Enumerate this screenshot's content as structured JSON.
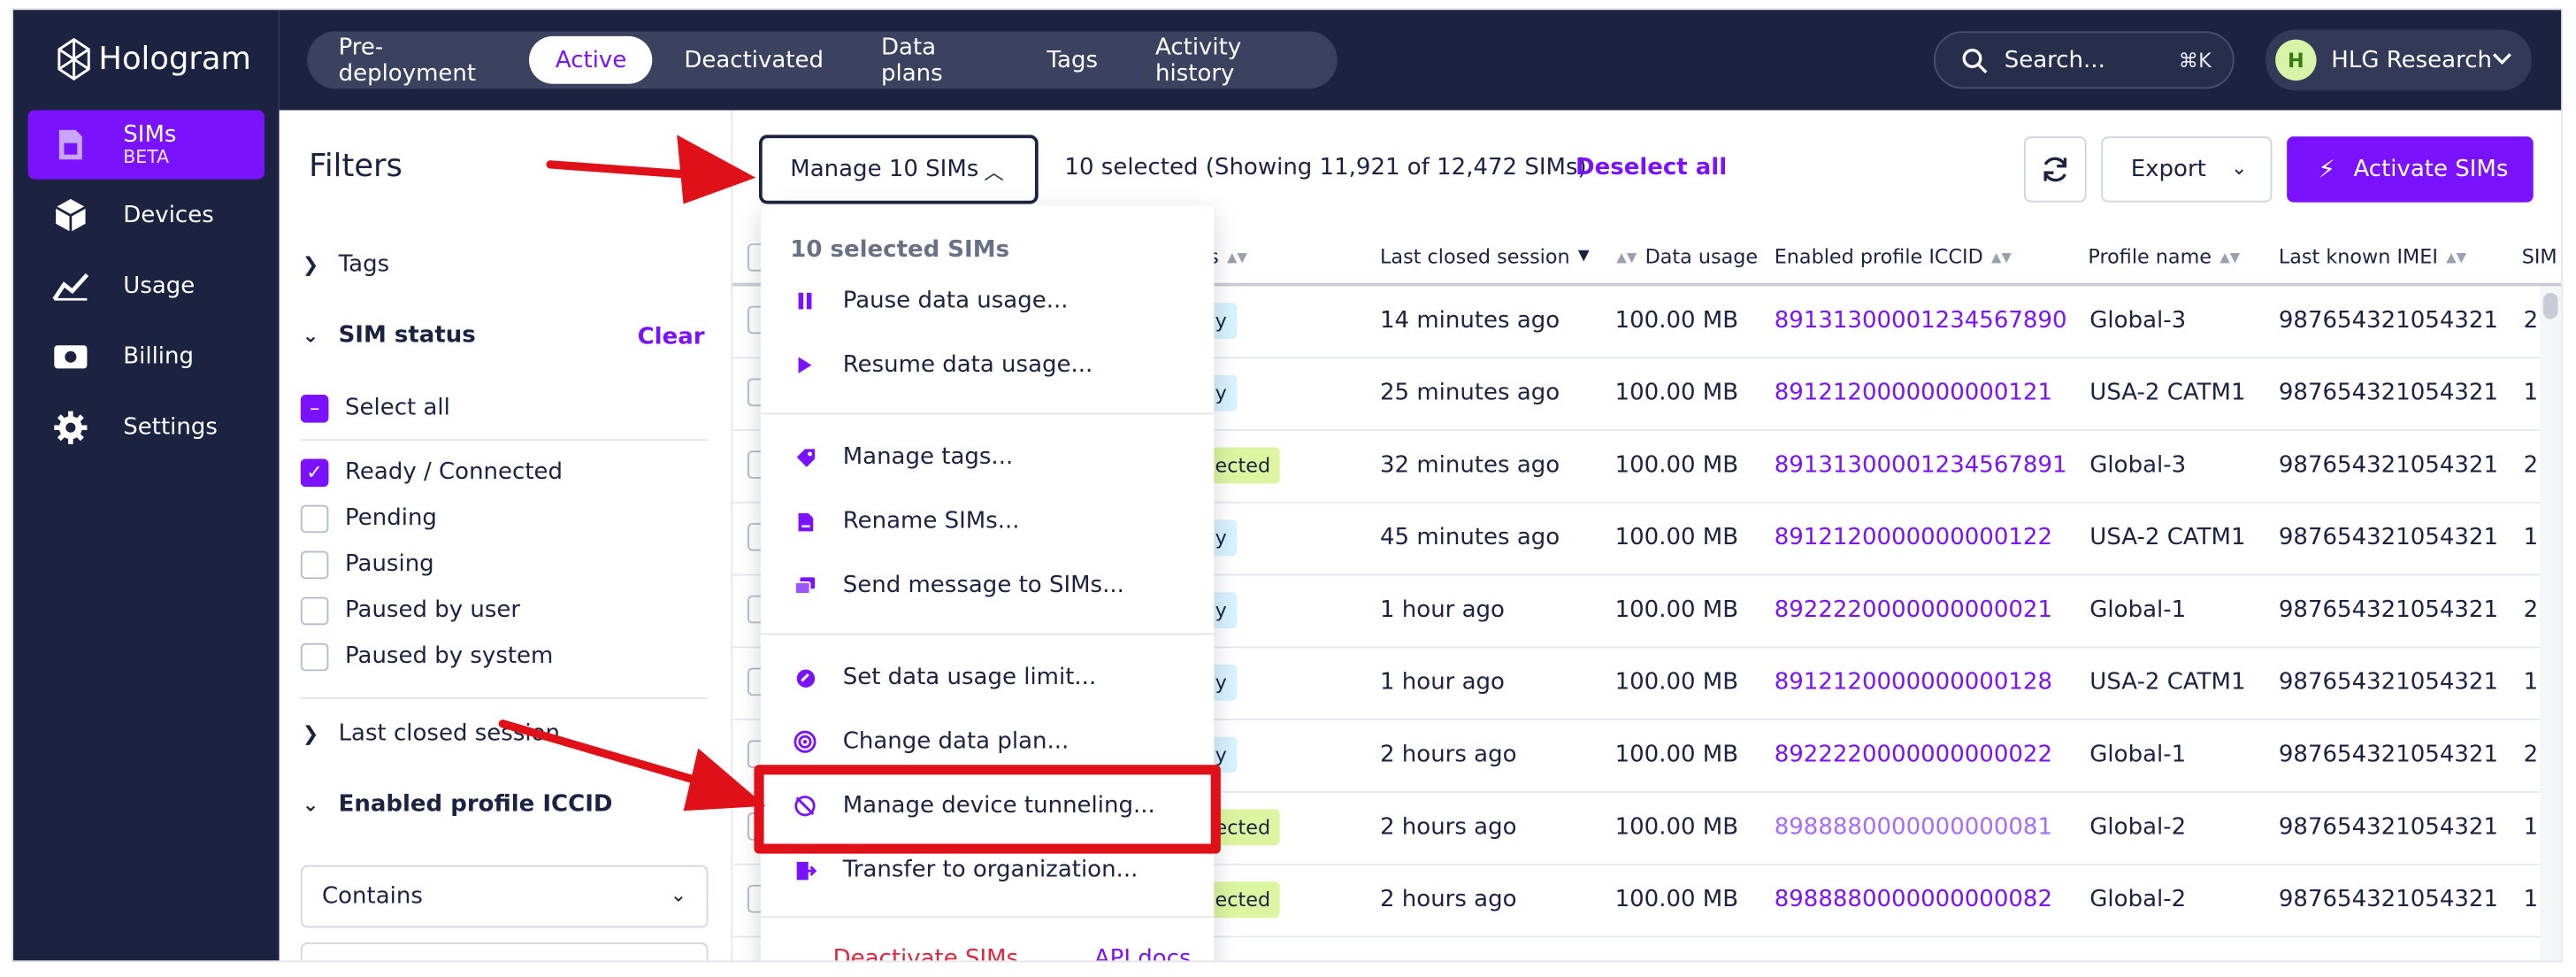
{
  "app": {
    "brand": "Hologram"
  },
  "sidebar": {
    "items": [
      {
        "label": "SIMs",
        "sub": "BETA",
        "icon": "sim-card-icon",
        "active": true
      },
      {
        "label": "Devices",
        "icon": "cube-icon"
      },
      {
        "label": "Usage",
        "icon": "chart-line-icon"
      },
      {
        "label": "Billing",
        "icon": "money-icon"
      },
      {
        "label": "Settings",
        "icon": "gear-icon"
      }
    ]
  },
  "topnav": {
    "tabs": [
      "Pre-deployment",
      "Active",
      "Deactivated",
      "Data plans",
      "Tags",
      "Activity history"
    ],
    "active_tab": "Active",
    "search_placeholder": "Search...",
    "search_shortcut": "⌘K",
    "org_initial": "H",
    "org_name": "HLG Research"
  },
  "filters": {
    "title": "Filters",
    "tags_label": "Tags",
    "sim_status_label": "SIM status",
    "clear_label": "Clear",
    "select_all": "Select all",
    "statuses": [
      {
        "label": "Ready / Connected",
        "checked": true
      },
      {
        "label": "Pending",
        "checked": false
      },
      {
        "label": "Pausing",
        "checked": false
      },
      {
        "label": "Paused by user",
        "checked": false
      },
      {
        "label": "Paused by system",
        "checked": false
      }
    ],
    "last_closed_label": "Last closed session",
    "iccid_label": "Enabled profile ICCID",
    "iccid_match": "Contains"
  },
  "toolbar": {
    "manage_label": "Manage 10 SIMs",
    "selected_text": "10 selected (Showing 11,921 of 12,472 SIMs)",
    "deselect_label": "Deselect all",
    "export_label": "Export",
    "activate_label": "Activate SIMs"
  },
  "table": {
    "headers": {
      "status_partial": "us",
      "last_closed": "Last closed session",
      "data_usage": "Data usage",
      "iccid": "Enabled profile ICCID",
      "profile": "Profile name",
      "imei": "Last known IMEI",
      "sim_partial": "SIM"
    },
    "rows": [
      {
        "badge": "dy",
        "badge_type": "ready",
        "last": "14 minutes ago",
        "usage": "100.00 MB",
        "iccid": "89131300001234567890",
        "profile": "Global-3",
        "imei": "987654321054321",
        "tail": "2"
      },
      {
        "badge": "dy",
        "badge_type": "ready",
        "last": "25 minutes ago",
        "usage": "100.00 MB",
        "iccid": "8912120000000000121",
        "profile": "USA-2 CATM1",
        "imei": "987654321054321",
        "tail": "1"
      },
      {
        "badge": "nected",
        "badge_type": "conn",
        "last": "32 minutes ago",
        "usage": "100.00 MB",
        "iccid": "89131300001234567891",
        "profile": "Global-3",
        "imei": "987654321054321",
        "tail": "2"
      },
      {
        "badge": "dy",
        "badge_type": "ready",
        "last": "45 minutes ago",
        "usage": "100.00 MB",
        "iccid": "8912120000000000122",
        "profile": "USA-2 CATM1",
        "imei": "987654321054321",
        "tail": "1"
      },
      {
        "badge": "dy",
        "badge_type": "ready",
        "last": "1 hour ago",
        "usage": "100.00 MB",
        "iccid": "8922220000000000021",
        "profile": "Global-1",
        "imei": "987654321054321",
        "tail": "2"
      },
      {
        "badge": "dy",
        "badge_type": "ready",
        "last": "1 hour ago",
        "usage": "100.00 MB",
        "iccid": "8912120000000000128",
        "profile": "USA-2 CATM1",
        "imei": "987654321054321",
        "tail": "1"
      },
      {
        "badge": "dy",
        "badge_type": "ready",
        "last": "2 hours ago",
        "usage": "100.00 MB",
        "iccid": "8922220000000000022",
        "profile": "Global-1",
        "imei": "987654321054321",
        "tail": "2"
      },
      {
        "badge": "nected",
        "badge_type": "conn",
        "last": "2 hours ago",
        "usage": "100.00 MB",
        "iccid": "8988880000000000081",
        "profile": "Global-2",
        "imei": "987654321054321",
        "tail": "1"
      },
      {
        "badge": "nected",
        "badge_type": "conn",
        "last": "2 hours ago",
        "usage": "100.00 MB",
        "iccid": "8988880000000000082",
        "profile": "Global-2",
        "imei": "987654321054321",
        "tail": "1"
      }
    ]
  },
  "menu": {
    "header": "10 selected SIMs",
    "items": [
      {
        "label": "Pause data usage...",
        "icon": "pause-icon"
      },
      {
        "label": "Resume data usage...",
        "icon": "play-icon"
      },
      {
        "label": "Manage tags...",
        "icon": "tag-icon"
      },
      {
        "label": "Rename SIMs...",
        "icon": "file-edit-icon"
      },
      {
        "label": "Send message to SIMs...",
        "icon": "messages-icon"
      },
      {
        "label": "Set data usage limit...",
        "icon": "limit-icon"
      },
      {
        "label": "Change data plan...",
        "icon": "signal-icon"
      },
      {
        "label": "Manage device tunneling...",
        "icon": "tunnel-off-icon"
      },
      {
        "label": "Transfer to organization...",
        "icon": "transfer-icon"
      }
    ],
    "footer_left": "Deactivate SIMs...",
    "footer_right": "API docs"
  },
  "colors": {
    "accent": "#7b12ff",
    "nav_bg": "#1b2341",
    "annotation_red": "#e01019"
  }
}
